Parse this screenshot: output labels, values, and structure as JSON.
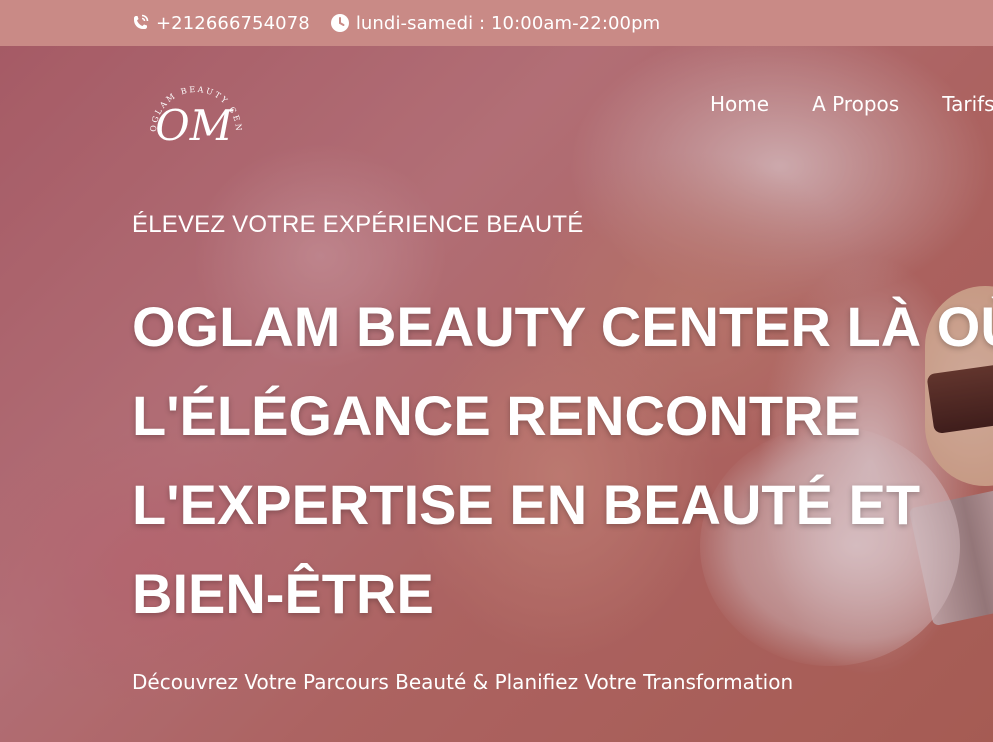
{
  "topbar": {
    "phone": "+212666754078",
    "hours": "lundi-samedi : 10:00am-22:00pm",
    "background": "#c98a86"
  },
  "logo": {
    "monogram": "OM",
    "arc_text": "OGLAM BEAUTY CENTER"
  },
  "nav": {
    "items": [
      "Home",
      "A Propos",
      "Tarifs"
    ]
  },
  "hero": {
    "kicker": "ÉLEVEZ VOTRE EXPÉRIENCE BEAUTÉ",
    "headline_lines": [
      "OGLAM BEAUTY CENTER LÀ OÙ",
      "L'ÉLÉGANCE RENCONTRE",
      "L'EXPERTISE EN BEAUTÉ ET",
      "BIEN-ÊTRE"
    ],
    "subtitle": "Découvrez Votre Parcours Beauté & Planifiez Votre Transformation"
  },
  "icons": {
    "phone": "phone-icon",
    "clock": "clock-icon"
  }
}
